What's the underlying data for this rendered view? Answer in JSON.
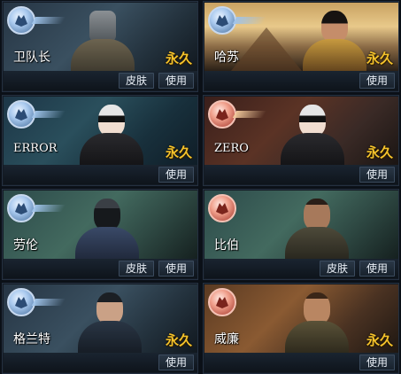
{
  "cards": [
    {
      "name": "卫队长",
      "permanent": "永久",
      "skin_label": "皮肤",
      "use_label": "使用",
      "badge": "wolf-emblem-icon",
      "theme": "blue"
    },
    {
      "name": "哈苏",
      "permanent": "永久",
      "skin_label": "",
      "use_label": "使用",
      "badge": "wolf-emblem-icon",
      "theme": "blue"
    },
    {
      "name": "ERROR",
      "permanent": "永久",
      "skin_label": "",
      "use_label": "使用",
      "badge": "wolf-emblem-icon",
      "theme": "blue"
    },
    {
      "name": "ZERO",
      "permanent": "永久",
      "skin_label": "",
      "use_label": "使用",
      "badge": "wolf-emblem-icon",
      "theme": "red"
    },
    {
      "name": "劳伦",
      "permanent": "",
      "skin_label": "皮肤",
      "use_label": "使用",
      "badge": "wolf-emblem-icon",
      "theme": "blue"
    },
    {
      "name": "比伯",
      "permanent": "",
      "skin_label": "皮肤",
      "use_label": "使用",
      "badge": "wolf-emblem-icon",
      "theme": "red"
    },
    {
      "name": "格兰特",
      "permanent": "永久",
      "skin_label": "",
      "use_label": "使用",
      "badge": "wolf-emblem-icon",
      "theme": "blue"
    },
    {
      "name": "威廉",
      "permanent": "永久",
      "skin_label": "",
      "use_label": "使用",
      "badge": "wolf-emblem-icon",
      "theme": "red"
    }
  ],
  "colors": {
    "permanent": "#f4c22b",
    "blue_badge": "#a9c9ee",
    "red_badge": "#f0a08c"
  }
}
